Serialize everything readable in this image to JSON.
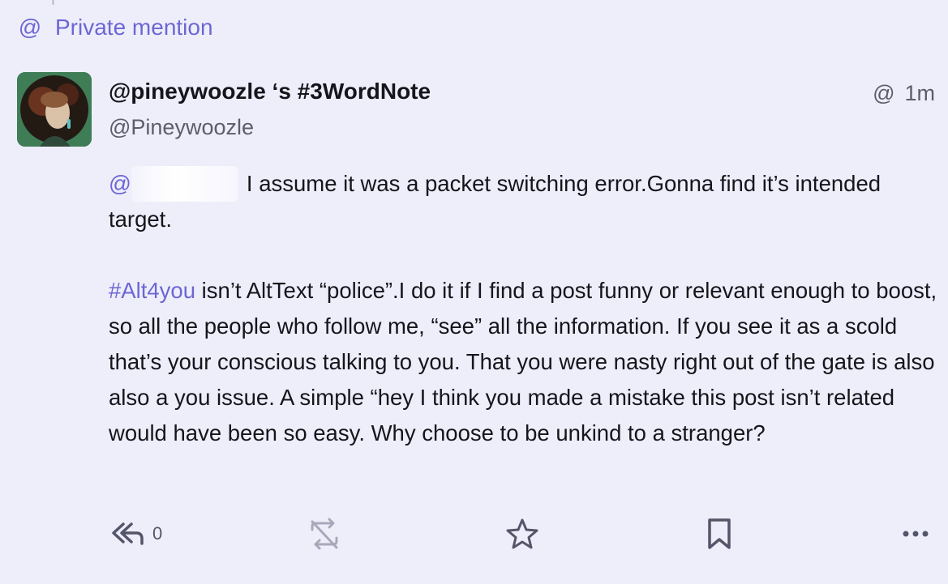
{
  "notification": {
    "label": "Private mention"
  },
  "status": {
    "display_name": "@pineywoozle ‘s #3WordNote",
    "handle": "@Pineywoozle",
    "visibility_icon": "at-icon",
    "timestamp": "1m",
    "mention_prefix": "@",
    "paragraph1_text": "I assume it was a packet switching error.Gonna find it’s intended target.",
    "hashtag": "#Alt4you",
    "paragraph2_text": " isn’t AltText “police”.I do it if I find a post funny or relevant enough to boost, so all the people who follow me, “see” all the information.  If you see it as a scold that’s your conscious talking to you. That you were nasty right out of the gate is also also a you issue. A simple “hey I think you made a mistake this post isn’t related would have been so easy.  Why choose to be unkind to a stranger?"
  },
  "actions": {
    "reply_count": "0",
    "icons": [
      "reply-all-icon",
      "boost-disabled-icon",
      "favourite-star-icon",
      "bookmark-icon",
      "more-icon"
    ]
  },
  "colors": {
    "accent": "#6d66d4",
    "background": "#eeeefa",
    "text": "#15151c",
    "muted": "#5c5c6b"
  }
}
